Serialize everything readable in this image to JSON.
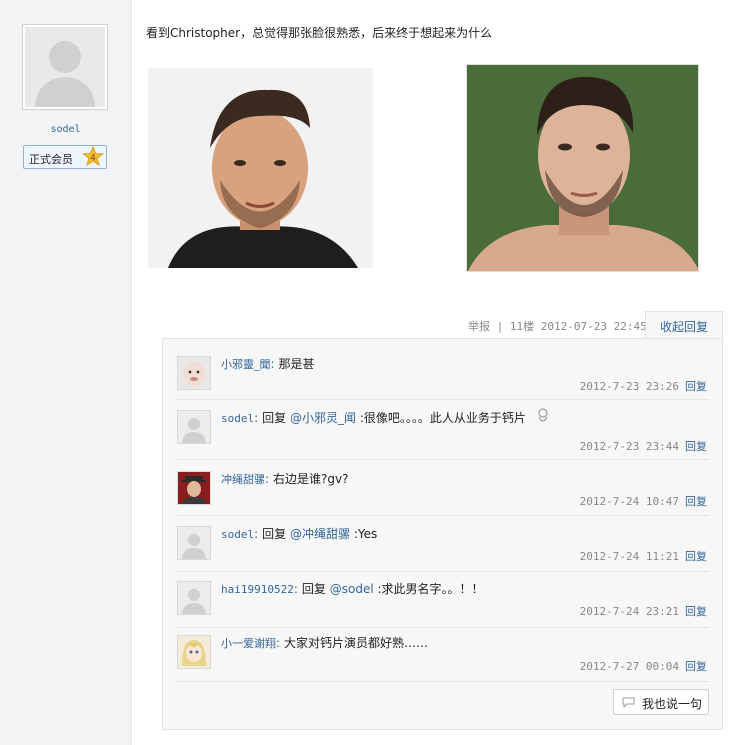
{
  "user": {
    "name": "sodel",
    "badge_label": "正式会员",
    "badge_level": "4"
  },
  "post": {
    "text": "看到Christopher，总觉得那张脸很熟悉，后来终于想起来为什么",
    "report_label": "举报",
    "floor_info": "| 11楼 2012-07-23 22:45",
    "collapse_label": "收起回复"
  },
  "replies": [
    {
      "name": "小邪靈_聞",
      "colon": ":",
      "prefix": "",
      "mention": "",
      "text": "那是甚",
      "time": "2012-7-23 23:26",
      "reply_label": "回复"
    },
    {
      "name": "sodel",
      "colon": ":",
      "prefix": "回复 ",
      "mention": "@小邪灵_闻",
      "text": " :很像吧。。。。此人从业务于钙片",
      "time": "2012-7-23 23:44",
      "reply_label": "回复"
    },
    {
      "name": "冲绳甜骡",
      "colon": ":",
      "prefix": "",
      "mention": "",
      "text": "右边是谁?gv?",
      "time": "2012-7-24 10:47",
      "reply_label": "回复"
    },
    {
      "name": "sodel",
      "colon": ":",
      "prefix": "回复 ",
      "mention": "@冲绳甜骡",
      "text": " :Yes",
      "time": "2012-7-24 11:21",
      "reply_label": "回复"
    },
    {
      "name": "hai19910522",
      "colon": ":",
      "prefix": "回复 ",
      "mention": "@sodel",
      "text": " :求此男名字。。！！",
      "time": "2012-7-24 23:21",
      "reply_label": "回复"
    },
    {
      "name": "小一爱谢翔",
      "colon": ":",
      "prefix": "",
      "mention": "",
      "text": "大家对钙片演员都好熟……",
      "time": "2012-7-27 00:04",
      "reply_label": "回复"
    }
  ],
  "say_button_label": "我也说一句",
  "colors": {
    "link": "#336699",
    "meta": "#888888",
    "sidebar": "#f2f3f5"
  }
}
